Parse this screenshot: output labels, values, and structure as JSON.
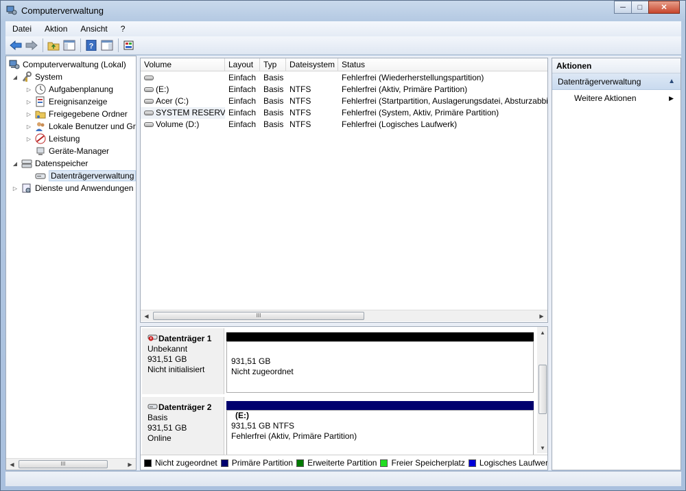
{
  "window": {
    "title": "Computerverwaltung",
    "minimize_glyph": "─",
    "maximize_glyph": "□",
    "close_glyph": "✕"
  },
  "menu": [
    {
      "label": "Datei"
    },
    {
      "label": "Aktion"
    },
    {
      "label": "Ansicht"
    },
    {
      "label": "?"
    }
  ],
  "tree": {
    "root": "Computerverwaltung (Lokal)",
    "system": "System",
    "items": [
      "Aufgabenplanung",
      "Ereignisanzeige",
      "Freigegebene Ordner",
      "Lokale Benutzer und Gr",
      "Leistung",
      "Geräte-Manager"
    ],
    "storage": "Datenspeicher",
    "selected": "Datenträgerverwaltung",
    "services": "Dienste und Anwendungen"
  },
  "volumes": {
    "columns": [
      "Volume",
      "Layout",
      "Typ",
      "Dateisystem",
      "Status"
    ],
    "rows": [
      {
        "volume": "",
        "layout": "Einfach",
        "typ": "Basis",
        "fs": "",
        "status": "Fehlerfrei (Wiederherstellungspartition)"
      },
      {
        "volume": "(E:)",
        "layout": "Einfach",
        "typ": "Basis",
        "fs": "NTFS",
        "status": "Fehlerfrei (Aktiv, Primäre Partition)"
      },
      {
        "volume": "Acer (C:)",
        "layout": "Einfach",
        "typ": "Basis",
        "fs": "NTFS",
        "status": "Fehlerfrei (Startpartition, Auslagerungsdatei, Absturzabbil"
      },
      {
        "volume": "SYSTEM RESERVED",
        "layout": "Einfach",
        "typ": "Basis",
        "fs": "NTFS",
        "status": "Fehlerfrei (System, Aktiv, Primäre Partition)"
      },
      {
        "volume": "Volume (D:)",
        "layout": "Einfach",
        "typ": "Basis",
        "fs": "NTFS",
        "status": "Fehlerfrei (Logisches Laufwerk)"
      }
    ]
  },
  "disks": [
    {
      "name": "Datenträger 1",
      "type": "Unbekannt",
      "size": "931,51 GB",
      "state": "Nicht initialisiert",
      "part_title": "",
      "part_line1": "931,51 GB",
      "part_line2": "Nicht zugeordnet",
      "bar_color": "#000000"
    },
    {
      "name": "Datenträger 2",
      "type": "Basis",
      "size": "931,51 GB",
      "state": "Online",
      "part_title": "(E:)",
      "part_line1": "931,51 GB NTFS",
      "part_line2": "Fehlerfrei (Aktiv, Primäre Partition)",
      "bar_color": "#00006e"
    }
  ],
  "legend": [
    {
      "label": "Nicht zugeordnet",
      "color": "#000000"
    },
    {
      "label": "Primäre Partition",
      "color": "#00006e"
    },
    {
      "label": "Erweiterte Partition",
      "color": "#007a00"
    },
    {
      "label": "Freier Speicherplatz",
      "color": "#22dd22"
    },
    {
      "label": "Logisches Laufwerk",
      "color": "#0000d8"
    }
  ],
  "actions": {
    "header": "Aktionen",
    "section": "Datenträgerverwaltung",
    "item": "Weitere Aktionen"
  },
  "scroll_grip": "III"
}
